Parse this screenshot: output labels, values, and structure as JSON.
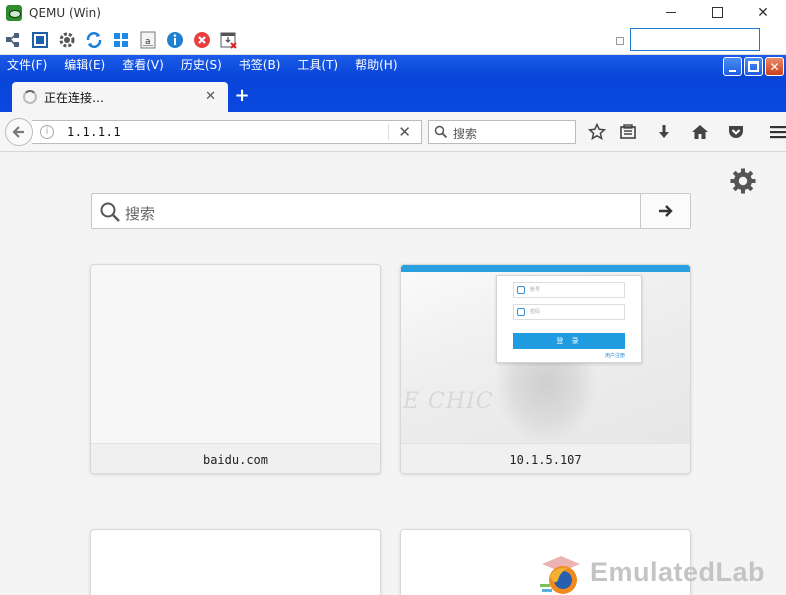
{
  "qemu": {
    "title": "QEMU (Win)",
    "window_close": "✕"
  },
  "firefox": {
    "menu": [
      "文件(F)",
      "编辑(E)",
      "查看(V)",
      "历史(S)",
      "书签(B)",
      "工具(T)",
      "帮助(H)"
    ],
    "tab": {
      "title": "正在连接…",
      "close": "✕"
    },
    "new_tab": "+",
    "url": "1.1.1.1",
    "url_clear": "✕",
    "search_placeholder": "搜索"
  },
  "newtab": {
    "search_placeholder": "搜索",
    "tiles": [
      {
        "label": "baidu.com"
      },
      {
        "label": "10.1.5.107"
      }
    ],
    "login_thumb": {
      "user_placeholder": "账号",
      "pass_placeholder": "密码",
      "button": "登 录",
      "link": "用户注册"
    }
  },
  "watermark": {
    "text": "EmulatedLab"
  },
  "colors": {
    "xp_blue": "#0a48e0",
    "qemu_input_border": "#1e78d4",
    "login_blue": "#1f9be0"
  }
}
